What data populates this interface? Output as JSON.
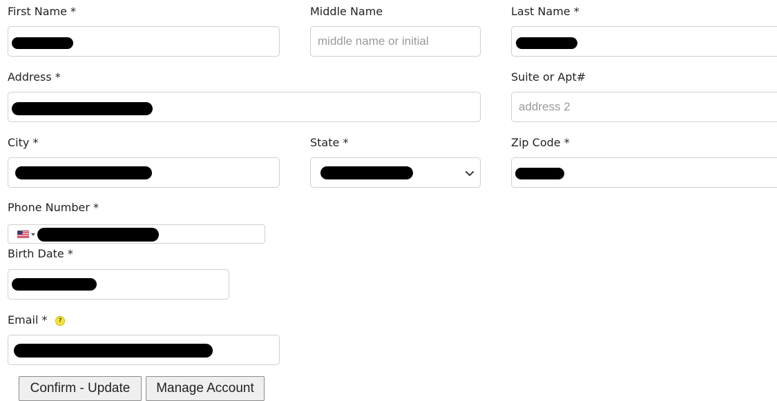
{
  "form": {
    "first_name": {
      "label": "First Name *"
    },
    "middle_name": {
      "label": "Middle Name",
      "placeholder": "middle name or initial"
    },
    "last_name": {
      "label": "Last Name *"
    },
    "address": {
      "label": "Address *"
    },
    "suite": {
      "label": "Suite or Apt#",
      "placeholder": "address 2"
    },
    "city": {
      "label": "City *"
    },
    "state": {
      "label": "State *"
    },
    "zip": {
      "label": "Zip Code *"
    },
    "phone": {
      "label": "Phone Number *",
      "country_flag_icon": "us-flag-icon"
    },
    "birth_date": {
      "label": "Birth Date *"
    },
    "email": {
      "label": "Email *",
      "help_icon": "question-help-icon",
      "help_glyph": "?"
    }
  },
  "actions": {
    "confirm_label": "Confirm - Update",
    "manage_label": "Manage Account"
  },
  "colors": {
    "input_border": "#cfcfcf",
    "placeholder": "#9a9a9a",
    "redaction": "#000000",
    "help_icon": "#f5e53a"
  }
}
